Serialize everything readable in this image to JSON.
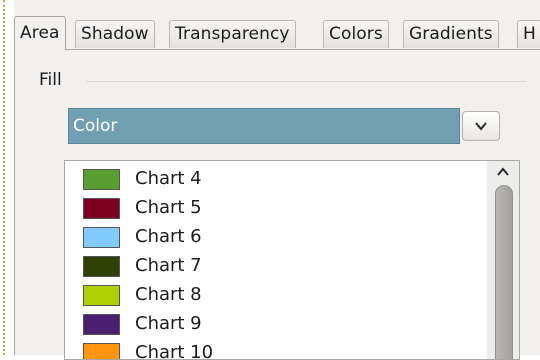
{
  "tabs": [
    {
      "label": "Area",
      "active": true
    },
    {
      "label": "Shadow"
    },
    {
      "label": "Transparency"
    },
    {
      "label": "Colors"
    },
    {
      "label": "Gradients"
    },
    {
      "label": "H"
    }
  ],
  "fill": {
    "label": "Fill",
    "selected": "Color",
    "dropdown_icon": "chevron-down-icon"
  },
  "color_list": [
    {
      "label": "Chart 4",
      "color": "#5a9e32"
    },
    {
      "label": "Chart 5",
      "color": "#7e0021"
    },
    {
      "label": "Chart 6",
      "color": "#83caff"
    },
    {
      "label": "Chart 7",
      "color": "#314004"
    },
    {
      "label": "Chart 8",
      "color": "#aecf00"
    },
    {
      "label": "Chart 9",
      "color": "#4b1f6f"
    },
    {
      "label": "Chart 10",
      "color": "#ff950e"
    }
  ],
  "scrollbar": {
    "up_icon": "chevron-up-icon"
  }
}
